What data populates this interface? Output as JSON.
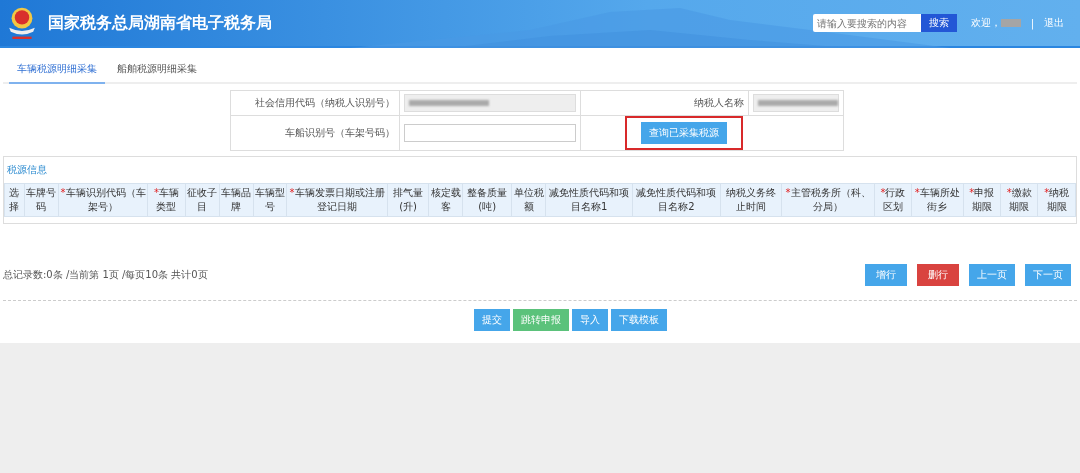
{
  "header": {
    "title": "国家税务总局湖南省电子税务局",
    "search": {
      "placeholder": "请输入要搜索的内容",
      "button": "搜索"
    },
    "welcome": "欢迎，",
    "separator": "|",
    "logout": "退出"
  },
  "tabs": [
    {
      "label": "车辆税源明细采集",
      "selected": true
    },
    {
      "label": "船舶税源明细采集",
      "selected": false
    }
  ],
  "form": {
    "rows": [
      {
        "cells": [
          {
            "kind": "label",
            "text": "社会信用代码（纳税人识别号）"
          },
          {
            "kind": "redacted"
          },
          {
            "kind": "label",
            "text": "纳税人名称"
          },
          {
            "kind": "redacted"
          }
        ]
      },
      {
        "cells": [
          {
            "kind": "label",
            "text": "车船识别号（车架号码）"
          },
          {
            "kind": "input"
          },
          {
            "kind": "button",
            "text": "查询已采集税源",
            "highlighted": true
          }
        ]
      }
    ]
  },
  "section_title": "税源信息",
  "table": {
    "columns": [
      {
        "label": "选择",
        "required": false
      },
      {
        "label": "车牌号码",
        "required": false
      },
      {
        "label": "车辆识别代码（车架号）",
        "required": true
      },
      {
        "label": "车辆类型",
        "required": true
      },
      {
        "label": "征收子目",
        "required": false
      },
      {
        "label": "车辆品牌",
        "required": false
      },
      {
        "label": "车辆型号",
        "required": false
      },
      {
        "label": "车辆发票日期或注册登记日期",
        "required": true
      },
      {
        "label": "排气量(升)",
        "required": false
      },
      {
        "label": "核定载客",
        "required": false
      },
      {
        "label": "整备质量(吨)",
        "required": false
      },
      {
        "label": "单位税额",
        "required": false
      },
      {
        "label": "减免性质代码和项目名称1",
        "required": false
      },
      {
        "label": "减免性质代码和项目名称2",
        "required": false
      },
      {
        "label": "纳税义务终止时间",
        "required": false
      },
      {
        "label": "主管税务所（科、分局）",
        "required": true
      },
      {
        "label": "行政区划",
        "required": true
      },
      {
        "label": "车辆所处街乡",
        "required": true
      },
      {
        "label": "申报期限",
        "required": true
      },
      {
        "label": "缴款期限",
        "required": true
      },
      {
        "label": "纳税期限",
        "required": true
      }
    ]
  },
  "required_mark": "*",
  "pagination": {
    "summary": "总记录数:0条 /当前第 1页 /每页10条 共计0页",
    "buttons": [
      {
        "label": "增行",
        "kind": "primary"
      },
      {
        "label": "删行",
        "kind": "danger"
      },
      {
        "label": "上一页",
        "kind": "primary"
      },
      {
        "label": "下一页",
        "kind": "primary"
      }
    ]
  },
  "actions": [
    {
      "label": "提交",
      "kind": "primary"
    },
    {
      "label": "跳转申报",
      "kind": "success"
    },
    {
      "label": "导入",
      "kind": "primary"
    },
    {
      "label": "下载模板",
      "kind": "primary"
    }
  ]
}
